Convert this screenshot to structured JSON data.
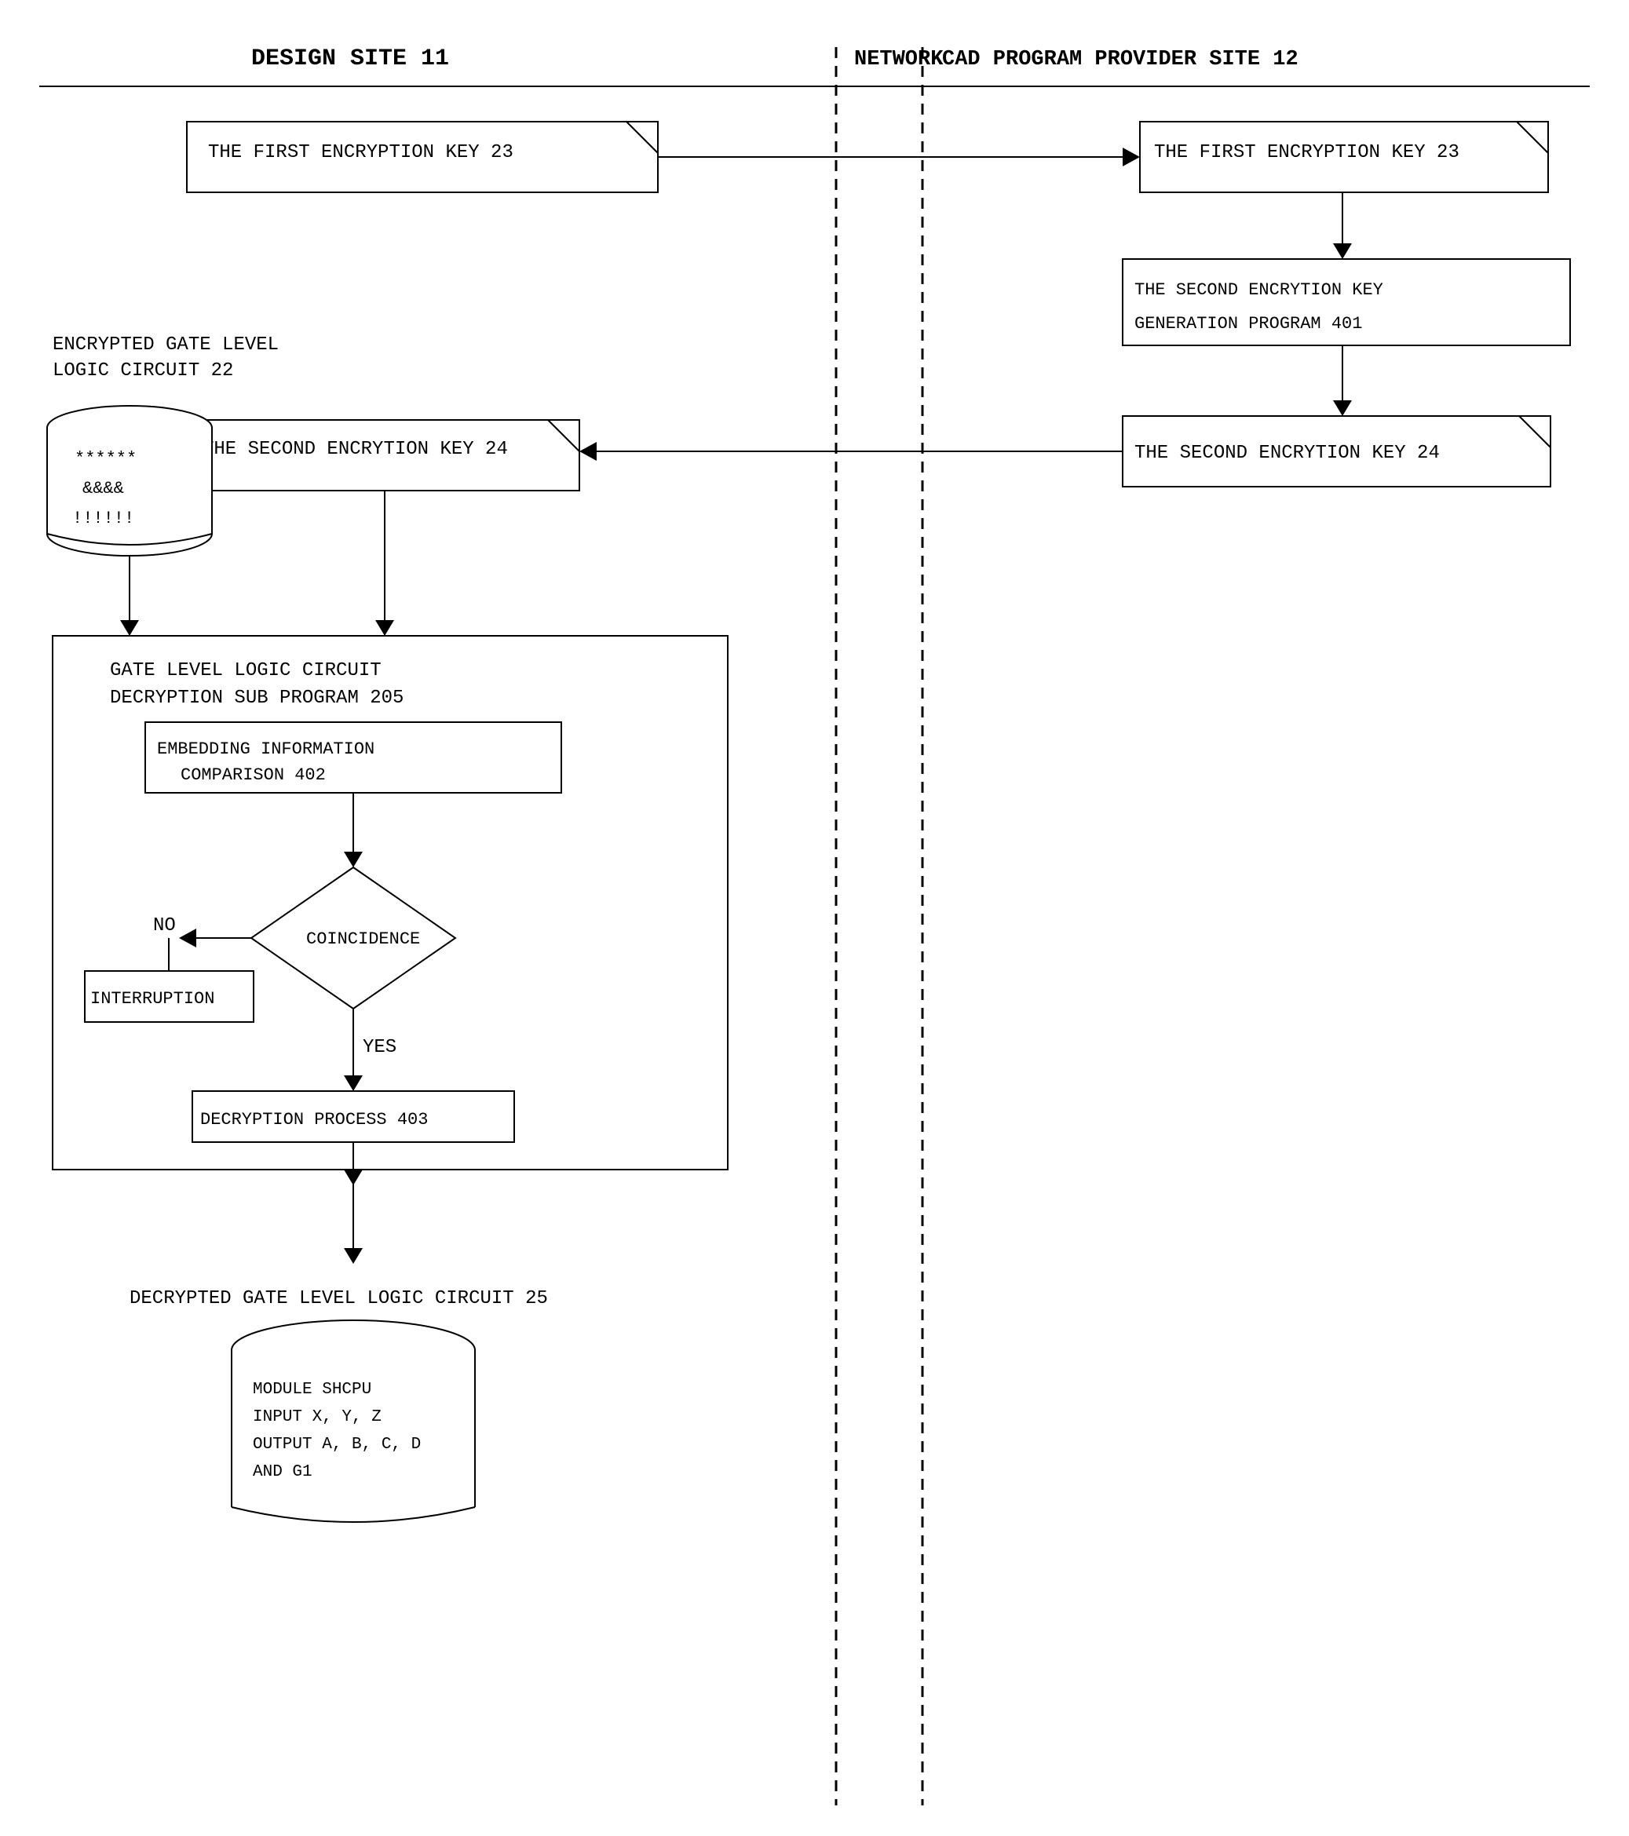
{
  "header": {
    "design_site_label": "DESIGN SITE 11",
    "network_label": "NETWORK",
    "cad_program_label": "CAD PROGRAM PROVIDER SITE 12"
  },
  "nodes": {
    "first_key_left_label": "THE FIRST ENCRYPTION KEY 23",
    "first_key_right_label": "THE FIRST ENCRYPTION KEY 23",
    "second_key_gen_label": "THE SECOND ENCRYTION KEY\nGENERATION PROGRAM 401",
    "second_key_right_label": "THE SECOND ENCRYTION KEY 24",
    "second_key_left_label": "THE SECOND ENCRYTION KEY 24",
    "encrypted_gate_label": "ENCRYPTED GATE LEVEL\nLOGIC CIRCUIT 22",
    "gate_decrypt_outer_label": "GATE LEVEL LOGIC CIRCUIT\nDECRYPTION SUB PROGRAM 205",
    "embedding_compare_label": "EMBEDDING INFORMATION\nCOMPARISON 402",
    "coincidence_label": "COINCIDENCE",
    "no_label": "NO",
    "yes_label": "YES",
    "interruption_label": "INTERRUPTION",
    "decryption_process_label": "DECRYPTION PROCESS 403",
    "decrypted_gate_label": "DECRYPTED GATE LEVEL LOGIC CIRCUIT 25",
    "cylinder_content": "MODULE SHCPU\nINPUT X, Y, Z\nOUTPUT A, B, C, D\nAND G1",
    "encrypted_content": "******\n&&&&\n!!!!!!"
  }
}
